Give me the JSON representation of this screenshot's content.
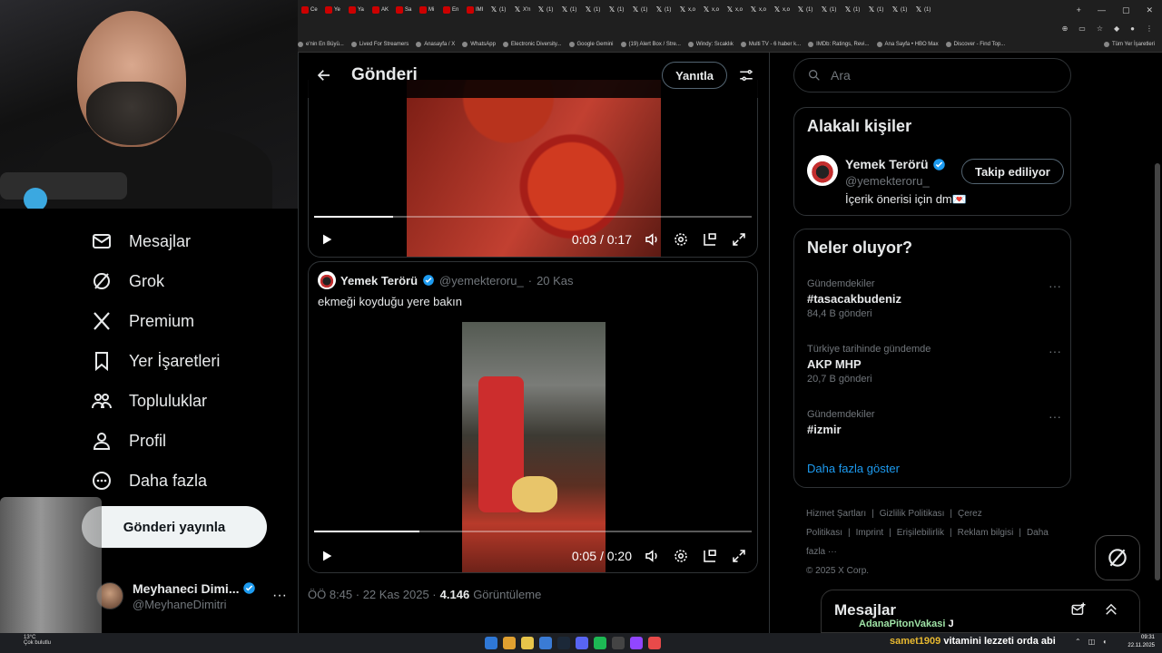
{
  "browser": {
    "tabs": [
      "Ce",
      "Ye",
      "Ya",
      "AK",
      "Sa",
      "Mi",
      "En",
      "IMI",
      "(1)",
      "X'n",
      "(1)",
      "(1)",
      "(1)",
      "(1)",
      "(1)",
      "(1)",
      "x,o",
      "x,o",
      "x,o",
      "x,o",
      "x,o",
      "(1)",
      "(1)",
      "(1)",
      "(1)",
      "(1)",
      "(1)"
    ],
    "bookmarks": [
      "e'nin En Büyü...",
      "Lived For Streamers",
      "Anasayfa / X",
      "WhatsApp",
      "Electronic Diversity...",
      "Google Gemini",
      "(19) Alert Box / Stre...",
      "Windy: Sıcaklık",
      "Multi TV - 6 haber k...",
      "IMDb: Ratings, Revi...",
      "Ana Sayfa • HBO Max",
      "Discover - Find Top..."
    ],
    "bookmarks_right": "Tüm Yer İşaretleri"
  },
  "nav": {
    "items": [
      "Mesajlar",
      "Grok",
      "Premium",
      "Yer İşaretleri",
      "Topluluklar",
      "Profil",
      "Daha fazla"
    ],
    "post_button": "Gönderi yayınla",
    "profile_name": "Meyhaneci Dimi...",
    "profile_handle": "@MeyhaneDimitri",
    "more": "···"
  },
  "header": {
    "title": "Gönderi",
    "reply_button": "Yanıtla"
  },
  "video1": {
    "time": "0:03 / 0:17",
    "progress": 0.18
  },
  "quote": {
    "author": "Yemek Terörü",
    "handle": "@yemekteroru_",
    "sep": "·",
    "date": "20 Kas",
    "text": "ekmeği koyduğu yere bakın",
    "video_time": "0:05 / 0:20",
    "progress": 0.24
  },
  "post_meta": {
    "time": "ÖÖ 8:45 · 22 Kas 2025 ·",
    "views_count": "4.146",
    "views_label": "Görüntüleme"
  },
  "search": {
    "placeholder": "Ara"
  },
  "related": {
    "title": "Alakalı kişiler",
    "name": "Yemek Terörü",
    "handle": "@yemekteroru_",
    "bio": "İçerik önerisi için dm💌",
    "follow_button": "Takip ediliyor"
  },
  "trends": {
    "title": "Neler oluyor?",
    "items": [
      {
        "context": "Gündemdekiler",
        "name": "#tasacakbudeniz",
        "count": "84,4 B gönderi"
      },
      {
        "context": "Türkiye tarihinde gündemde",
        "name": "AKP MHP",
        "count": "20,7 B gönderi"
      },
      {
        "context": "Gündemdekiler",
        "name": "#izmir",
        "count": ""
      }
    ],
    "more": "···",
    "show_more": "Daha fazla göster"
  },
  "footer": {
    "links": [
      "Hizmet Şartları",
      "|",
      "Gizlilik Politikası",
      "|",
      "Çerez Politikası",
      "|",
      "Imprint",
      "|",
      "Erişilebilirlik",
      "|",
      "Reklam bilgisi",
      "|",
      "Daha fazla ···"
    ],
    "copyright": "© 2025 X Corp."
  },
  "messages_drawer": {
    "title": "Mesajlar",
    "overlay_user": "AdanaPitonVakasi",
    "overlay_text": "J"
  },
  "taskbar": {
    "chat_user": "samet1909",
    "chat_text": "vitamini lezzeti orda abi",
    "time": "09:31",
    "date": "22.11.2025",
    "weather_temp": "13°C",
    "weather_text": "Çok bulutlu"
  },
  "colors": {
    "accent": "#1d9bf0",
    "verified": "#1d9bf0",
    "text_secondary": "#71767b",
    "border": "#2f3336"
  }
}
